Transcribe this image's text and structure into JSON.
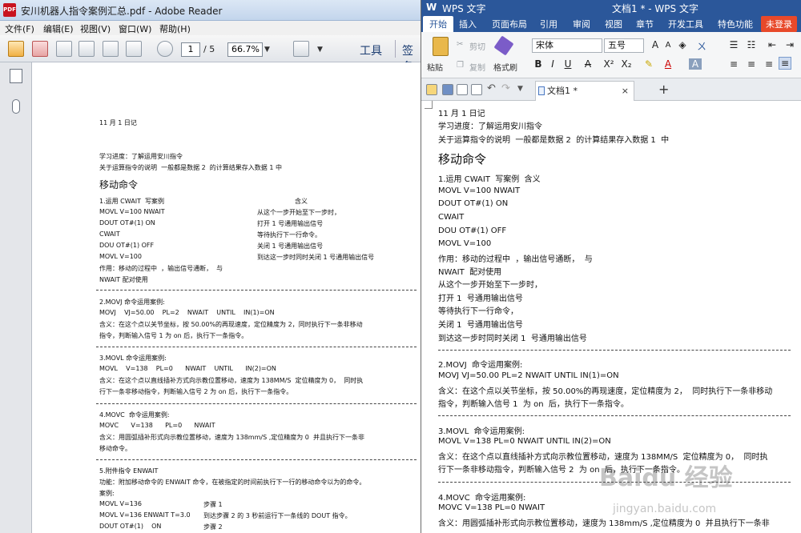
{
  "reader": {
    "title": "安川机器人指令案例汇总.pdf - Adobe Reader",
    "menu": [
      "文件(F)",
      "编辑(E)",
      "视图(V)",
      "窗口(W)",
      "帮助(H)"
    ],
    "page_current": "1",
    "page_total": "/ 5",
    "zoom": "66.7%",
    "tools_label": "工具",
    "sign_label": "签名",
    "lines": [
      "11 月 1 日记",
      "学习进度：了解运用安川指令",
      "关于运算指令的说明  一般都是数据 2  的计算结果存入数据 1 中",
      "移动命令",
      "1.运用 CWAIT  写案例",
      "含义",
      "MOVL V=100 NWAIT",
      "从这个一步开始至下一步时，",
      "DOUT OT#(1) ON",
      "打开 1 号通用输出信号",
      "CWAIT",
      "等待执行下一行命令。",
      "DOU OT#(1) OFF",
      "关闭 1 号通用输出信号",
      "MOVL V=100",
      "到达这一步时同时关闭 1 号通用输出信号",
      "作用：移动的过程中  ，输出信号通断，  与",
      "NWAIT 配对使用",
      "2.MOVJ 命令运用案例:",
      "MOVJ    VJ=50.00    PL=2    NWAIT    UNTIL    IN(1)=ON",
      "含义：在这个点以关节坐标，按 50.00%的再现速度，定位精度为 2，同时执行下一条非移动",
      "指令，判断输入信号 1 为 on 后，执行下一条指令。",
      "3.MOVL 命令运用案例:",
      "MOVL    V=138    PL=0      NWAIT    UNTIL      IN(2)=ON",
      "含义：在这个点以直线插补方式向示教位置移动，速度为 138MM/S  定位精度为 0，  同时执",
      "行下一条非移动指令，判断输入信号 2 为 on 后，执行下一条指令。",
      "4.MOVC  命令运用案例:",
      "MOVC      V=138      PL=0      NWAIT",
      "含义：用圆弧插补形式向示教位置移动，速度为 138mm/S ,定位精度为 0  并且执行下一条非",
      "移动命令。",
      "5.附件指令 ENWAIT",
      "功能：附加移动命令的 ENWAIT 命令，在被指定的时间前执行下一行的移动命令以为的命令。",
      "案例:",
      "MOVL V=136",
      "步骤 1",
      "MOVL V=136 ENWAIT T=3.0",
      "到达步骤 2 的 3 秒前运行下一条线的 DOUT 指令。",
      "DOUT OT#(1)    ON",
      "步骤 2"
    ],
    "separator": "------------------------------------------------------------------------------------------------------------"
  },
  "wps": {
    "app_name": "WPS 文字",
    "window_title": "文档1 * - WPS 文字",
    "tabs": [
      "开始",
      "插入",
      "页面布局",
      "引用",
      "审阅",
      "视图",
      "章节",
      "开发工具",
      "特色功能"
    ],
    "login": "未登录",
    "ribbon": {
      "paste": "粘贴",
      "cut": "剪切",
      "copy": "复制",
      "format_painter": "格式刷",
      "font": "宋体",
      "size": "五号"
    },
    "doc_tab": "文档1 *",
    "lines": [
      "11 月 1 日记",
      "学习进度：了解运用安川指令",
      "关于运算指令的说明  一般都是数据 2  的计算结果存入数据 1  中",
      "移动命令",
      "1.运用 CWAIT  写案例  含义",
      "MOVL V=100 NWAIT",
      "DOUT OT#(1) ON",
      "CWAIT",
      "DOU OT#(1) OFF",
      "MOVL V=100",
      "作用：移动的过程中  ，输出信号通断，  与",
      "NWAIT  配对使用",
      "从这个一步开始至下一步时，",
      "打开 1  号通用输出信号",
      "等待执行下一行命令，",
      "关闭 1  号通用输出信号",
      "到达这一步时同时关闭 1  号通用输出信号",
      "2.MOVJ  命令运用案例:",
      "MOVJ VJ=50.00 PL=2 NWAIT UNTIL IN(1)=ON",
      "含义：在这个点以关节坐标，按 50.00%的再现速度，定位精度为 2，  同时执行下一条非移动",
      "指令，判断输入信号 1  为 on  后，执行下一条指令。",
      "3.MOVL  命令运用案例:",
      "MOVL V=138 PL=0 NWAIT UNTIL IN(2)=ON",
      "含义：在这个点以直线插补方式向示教位置移动，速度为 138MM/S  定位精度为 0，  同时执",
      "行下一条非移动指令，判断输入信号 2  为 on  后，执行下一条指令。",
      "4.MOVC  命令运用案例:",
      "MOVC V=138 PL=0 NWAIT",
      "含义：用圆弧插补形式向示教位置移动，速度为 138mm/S ,定位精度为 0  并且执行下一条非"
    ],
    "separator": "--------------------------------------------------------------------------------------------------------------"
  },
  "watermark": {
    "brand": "Baidu 经验",
    "url": "jingyan.baidu.com"
  }
}
